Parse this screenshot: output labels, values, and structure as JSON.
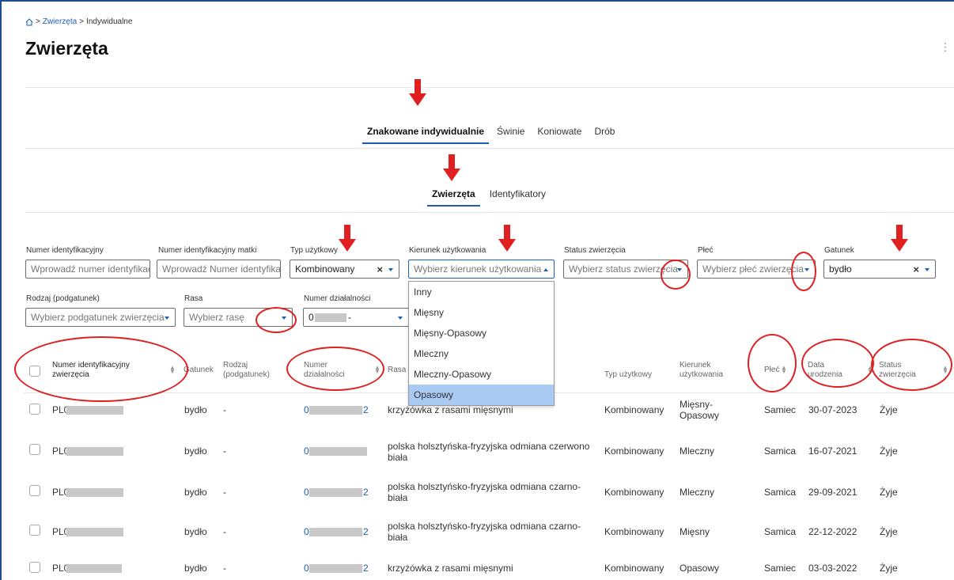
{
  "breadcrumb": {
    "home_icon": "home-icon",
    "separator": ">",
    "items": [
      "Zwierzęta",
      "Indywidualne"
    ]
  },
  "page_title": "Zwierzęta",
  "main_tabs": [
    {
      "label": "Znakowane indywidualnie",
      "active": true
    },
    {
      "label": "Świnie",
      "active": false
    },
    {
      "label": "Koniowate",
      "active": false
    },
    {
      "label": "Drób",
      "active": false
    }
  ],
  "sub_tabs": [
    {
      "label": "Zwierzęta",
      "active": true
    },
    {
      "label": "Identyfikatory",
      "active": false
    }
  ],
  "filters": {
    "numer_identyfikacyjny": {
      "label": "Numer identyfikacyjny",
      "placeholder": "Wprowadź numer identyfikacyjny"
    },
    "numer_matki": {
      "label": "Numer identyfikacyjny matki",
      "placeholder": "Wprowadź Numer identyfikacyjny matki"
    },
    "typ_uzytkowy": {
      "label": "Typ użytkowy",
      "value": "Kombinowany"
    },
    "kierunek": {
      "label": "Kierunek użytkowania",
      "placeholder": "Wybierz kierunek użytkowania"
    },
    "status": {
      "label": "Status zwierzęcia",
      "placeholder": "Wybierz status zwierzęcia"
    },
    "plec": {
      "label": "Płeć",
      "placeholder": "Wybierz płeć zwierzęcia"
    },
    "gatunek": {
      "label": "Gatunek",
      "value": "bydło"
    },
    "rodzaj": {
      "label": "Rodzaj (podgatunek)",
      "placeholder": "Wybierz podgatunek zwierzęcia"
    },
    "rasa": {
      "label": "Rasa",
      "placeholder": "Wybierz rasę"
    },
    "numer_dzialalnosci": {
      "label": "Numer działalności",
      "value": "0",
      "suffix": "-"
    }
  },
  "kierunek_options": [
    "Inny",
    "Mięsny",
    "Mięsny-Opasowy",
    "Mleczny",
    "Mleczny-Opasowy",
    "Opasowy"
  ],
  "kierunek_highlighted": "Opasowy",
  "table": {
    "headers": {
      "numer_id": "Numer identyfikacyjny zwierzęcia",
      "gatunek": "Gatunek",
      "rodzaj": "Rodzaj (podgatunek)",
      "numer_dzialalnosci": "Numer działalności",
      "rasa": "Rasa",
      "typ": "Typ użytkowy",
      "kierunek": "Kierunek użytkowania",
      "plec": "Płeć",
      "data": "Data urodzenia",
      "status": "Status zwierzęcia"
    },
    "rows": [
      {
        "id_prefix": "PL0",
        "gatunek": "bydło",
        "rodzaj": "-",
        "dz_prefix": "0",
        "dz_suffix": "2",
        "rasa": "krzyżówka z rasami mięsnymi",
        "typ": "Kombinowany",
        "kierunek": "Mięsny-Opasowy",
        "plec": "Samiec",
        "data": "30-07-2023",
        "status": "Żyje"
      },
      {
        "id_prefix": "PL0",
        "gatunek": "bydło",
        "rodzaj": "-",
        "dz_prefix": "0",
        "dz_suffix": "",
        "rasa": "polska holsztyńska-fryzyjska odmiana czerwono biała",
        "typ": "Kombinowany",
        "kierunek": "Mleczny",
        "plec": "Samica",
        "data": "16-07-2021",
        "status": "Żyje"
      },
      {
        "id_prefix": "PL0",
        "gatunek": "bydło",
        "rodzaj": "-",
        "dz_prefix": "0",
        "dz_suffix": "2",
        "rasa": "polska holsztyńsko-fryzyjska odmiana czarno-biała",
        "typ": "Kombinowany",
        "kierunek": "Mleczny",
        "plec": "Samica",
        "data": "29-09-2021",
        "status": "Żyje"
      },
      {
        "id_prefix": "PL0",
        "gatunek": "bydło",
        "rodzaj": "-",
        "dz_prefix": "0",
        "dz_suffix": "2",
        "rasa": "polska holsztyńsko-fryzyjska odmiana czarno-biała",
        "typ": "Kombinowany",
        "kierunek": "Mięsny",
        "plec": "Samica",
        "data": "22-12-2022",
        "status": "Żyje"
      },
      {
        "id_prefix": "PL0",
        "gatunek": "bydło",
        "rodzaj": "-",
        "dz_prefix": "0",
        "dz_suffix": "2",
        "rasa": "krzyżówka z rasami mięsnymi",
        "typ": "Kombinowany",
        "kierunek": "Opasowy",
        "plec": "Samiec",
        "data": "03-03-2022",
        "status": "Żyje"
      }
    ]
  },
  "colors": {
    "accent": "#1b5fb0",
    "annotation": "#e02020",
    "highlight": "#a9cbf3"
  }
}
